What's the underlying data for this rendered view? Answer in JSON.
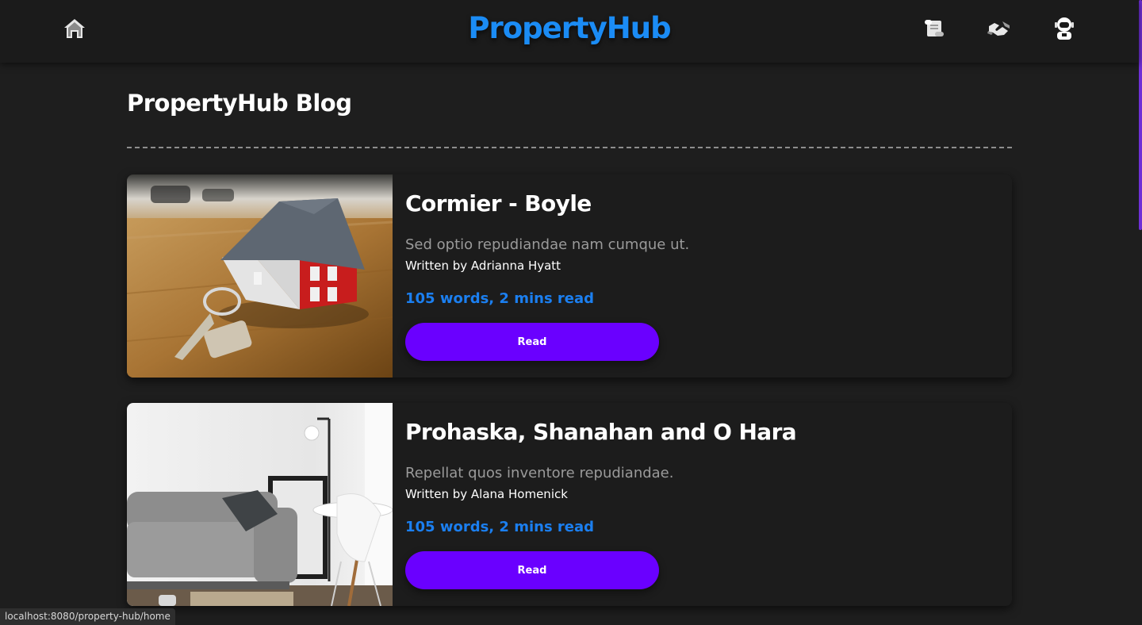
{
  "header": {
    "brand": "PropertyHub",
    "icons": [
      "home-icon",
      "scroll-icon",
      "handshake-icon",
      "astronaut-icon"
    ]
  },
  "page": {
    "title": "PropertyHub Blog"
  },
  "posts": [
    {
      "title": "Cormier - Boyle",
      "description": "Sed optio repudiandae nam cumque ut.",
      "author": "Written by Adrianna Hyatt",
      "meta": "105 words, 2 mins read",
      "button": "Read",
      "image": "house-model-with-keys"
    },
    {
      "title": "Prohaska, Shanahan and O Hara",
      "description": "Repellat quos inventore repudiandae.",
      "author": "Written by Alana Homenick",
      "meta": "105 words, 2 mins read",
      "button": "Read",
      "image": "living-room-sofa"
    }
  ],
  "status_bar": {
    "url": "localhost:8080/property-hub/home"
  },
  "colors": {
    "background": "#1e1e1e",
    "brand": "#1b8cf5",
    "accent_button": "#6a00ff",
    "meta_text": "#1b7ff0"
  }
}
